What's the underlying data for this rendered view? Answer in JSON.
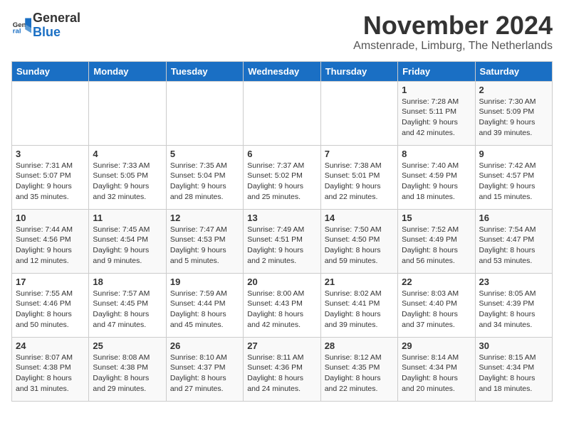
{
  "header": {
    "logo_general": "General",
    "logo_blue": "Blue",
    "month_title": "November 2024",
    "location": "Amstenrade, Limburg, The Netherlands"
  },
  "days_of_week": [
    "Sunday",
    "Monday",
    "Tuesday",
    "Wednesday",
    "Thursday",
    "Friday",
    "Saturday"
  ],
  "weeks": [
    [
      {
        "day": "",
        "info": ""
      },
      {
        "day": "",
        "info": ""
      },
      {
        "day": "",
        "info": ""
      },
      {
        "day": "",
        "info": ""
      },
      {
        "day": "",
        "info": ""
      },
      {
        "day": "1",
        "info": "Sunrise: 7:28 AM\nSunset: 5:11 PM\nDaylight: 9 hours and 42 minutes."
      },
      {
        "day": "2",
        "info": "Sunrise: 7:30 AM\nSunset: 5:09 PM\nDaylight: 9 hours and 39 minutes."
      }
    ],
    [
      {
        "day": "3",
        "info": "Sunrise: 7:31 AM\nSunset: 5:07 PM\nDaylight: 9 hours and 35 minutes."
      },
      {
        "day": "4",
        "info": "Sunrise: 7:33 AM\nSunset: 5:05 PM\nDaylight: 9 hours and 32 minutes."
      },
      {
        "day": "5",
        "info": "Sunrise: 7:35 AM\nSunset: 5:04 PM\nDaylight: 9 hours and 28 minutes."
      },
      {
        "day": "6",
        "info": "Sunrise: 7:37 AM\nSunset: 5:02 PM\nDaylight: 9 hours and 25 minutes."
      },
      {
        "day": "7",
        "info": "Sunrise: 7:38 AM\nSunset: 5:01 PM\nDaylight: 9 hours and 22 minutes."
      },
      {
        "day": "8",
        "info": "Sunrise: 7:40 AM\nSunset: 4:59 PM\nDaylight: 9 hours and 18 minutes."
      },
      {
        "day": "9",
        "info": "Sunrise: 7:42 AM\nSunset: 4:57 PM\nDaylight: 9 hours and 15 minutes."
      }
    ],
    [
      {
        "day": "10",
        "info": "Sunrise: 7:44 AM\nSunset: 4:56 PM\nDaylight: 9 hours and 12 minutes."
      },
      {
        "day": "11",
        "info": "Sunrise: 7:45 AM\nSunset: 4:54 PM\nDaylight: 9 hours and 9 minutes."
      },
      {
        "day": "12",
        "info": "Sunrise: 7:47 AM\nSunset: 4:53 PM\nDaylight: 9 hours and 5 minutes."
      },
      {
        "day": "13",
        "info": "Sunrise: 7:49 AM\nSunset: 4:51 PM\nDaylight: 9 hours and 2 minutes."
      },
      {
        "day": "14",
        "info": "Sunrise: 7:50 AM\nSunset: 4:50 PM\nDaylight: 8 hours and 59 minutes."
      },
      {
        "day": "15",
        "info": "Sunrise: 7:52 AM\nSunset: 4:49 PM\nDaylight: 8 hours and 56 minutes."
      },
      {
        "day": "16",
        "info": "Sunrise: 7:54 AM\nSunset: 4:47 PM\nDaylight: 8 hours and 53 minutes."
      }
    ],
    [
      {
        "day": "17",
        "info": "Sunrise: 7:55 AM\nSunset: 4:46 PM\nDaylight: 8 hours and 50 minutes."
      },
      {
        "day": "18",
        "info": "Sunrise: 7:57 AM\nSunset: 4:45 PM\nDaylight: 8 hours and 47 minutes."
      },
      {
        "day": "19",
        "info": "Sunrise: 7:59 AM\nSunset: 4:44 PM\nDaylight: 8 hours and 45 minutes."
      },
      {
        "day": "20",
        "info": "Sunrise: 8:00 AM\nSunset: 4:43 PM\nDaylight: 8 hours and 42 minutes."
      },
      {
        "day": "21",
        "info": "Sunrise: 8:02 AM\nSunset: 4:41 PM\nDaylight: 8 hours and 39 minutes."
      },
      {
        "day": "22",
        "info": "Sunrise: 8:03 AM\nSunset: 4:40 PM\nDaylight: 8 hours and 37 minutes."
      },
      {
        "day": "23",
        "info": "Sunrise: 8:05 AM\nSunset: 4:39 PM\nDaylight: 8 hours and 34 minutes."
      }
    ],
    [
      {
        "day": "24",
        "info": "Sunrise: 8:07 AM\nSunset: 4:38 PM\nDaylight: 8 hours and 31 minutes."
      },
      {
        "day": "25",
        "info": "Sunrise: 8:08 AM\nSunset: 4:38 PM\nDaylight: 8 hours and 29 minutes."
      },
      {
        "day": "26",
        "info": "Sunrise: 8:10 AM\nSunset: 4:37 PM\nDaylight: 8 hours and 27 minutes."
      },
      {
        "day": "27",
        "info": "Sunrise: 8:11 AM\nSunset: 4:36 PM\nDaylight: 8 hours and 24 minutes."
      },
      {
        "day": "28",
        "info": "Sunrise: 8:12 AM\nSunset: 4:35 PM\nDaylight: 8 hours and 22 minutes."
      },
      {
        "day": "29",
        "info": "Sunrise: 8:14 AM\nSunset: 4:34 PM\nDaylight: 8 hours and 20 minutes."
      },
      {
        "day": "30",
        "info": "Sunrise: 8:15 AM\nSunset: 4:34 PM\nDaylight: 8 hours and 18 minutes."
      }
    ]
  ]
}
